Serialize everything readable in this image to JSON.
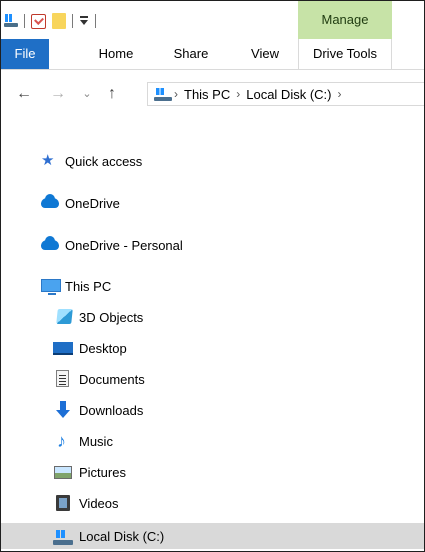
{
  "ribbon": {
    "context_group": "Manage",
    "tabs": {
      "file": "File",
      "home": "Home",
      "share": "Share",
      "view": "View",
      "drive_tools": "Drive Tools"
    }
  },
  "address": {
    "crumbs": [
      "This PC",
      "Local Disk (C:)"
    ],
    "chevron": "›"
  },
  "nav_buttons": {
    "back": "←",
    "forward": "→",
    "recent": "⌄",
    "up": "↑"
  },
  "nav_pane": {
    "quick_access": "Quick access",
    "onedrive": "OneDrive",
    "onedrive_personal": "OneDrive - Personal",
    "this_pc": "This PC",
    "objects_3d": "3D Objects",
    "desktop": "Desktop",
    "documents": "Documents",
    "downloads": "Downloads",
    "music": "Music",
    "pictures": "Pictures",
    "videos": "Videos",
    "local_disk": "Local Disk (C:)"
  },
  "icons": {
    "quick_access": "star-icon",
    "onedrive": "cloud-icon",
    "this_pc": "monitor-icon",
    "objects_3d": "cube-icon",
    "desktop": "desktop-icon",
    "documents": "document-icon",
    "downloads": "download-arrow-icon",
    "music": "music-note-icon",
    "pictures": "picture-icon",
    "videos": "film-icon",
    "local_disk": "drive-icon"
  },
  "colors": {
    "file_tab": "#1f6fc6",
    "manage_context": "#c7e3a7",
    "selected_row": "#d9d9d9"
  }
}
